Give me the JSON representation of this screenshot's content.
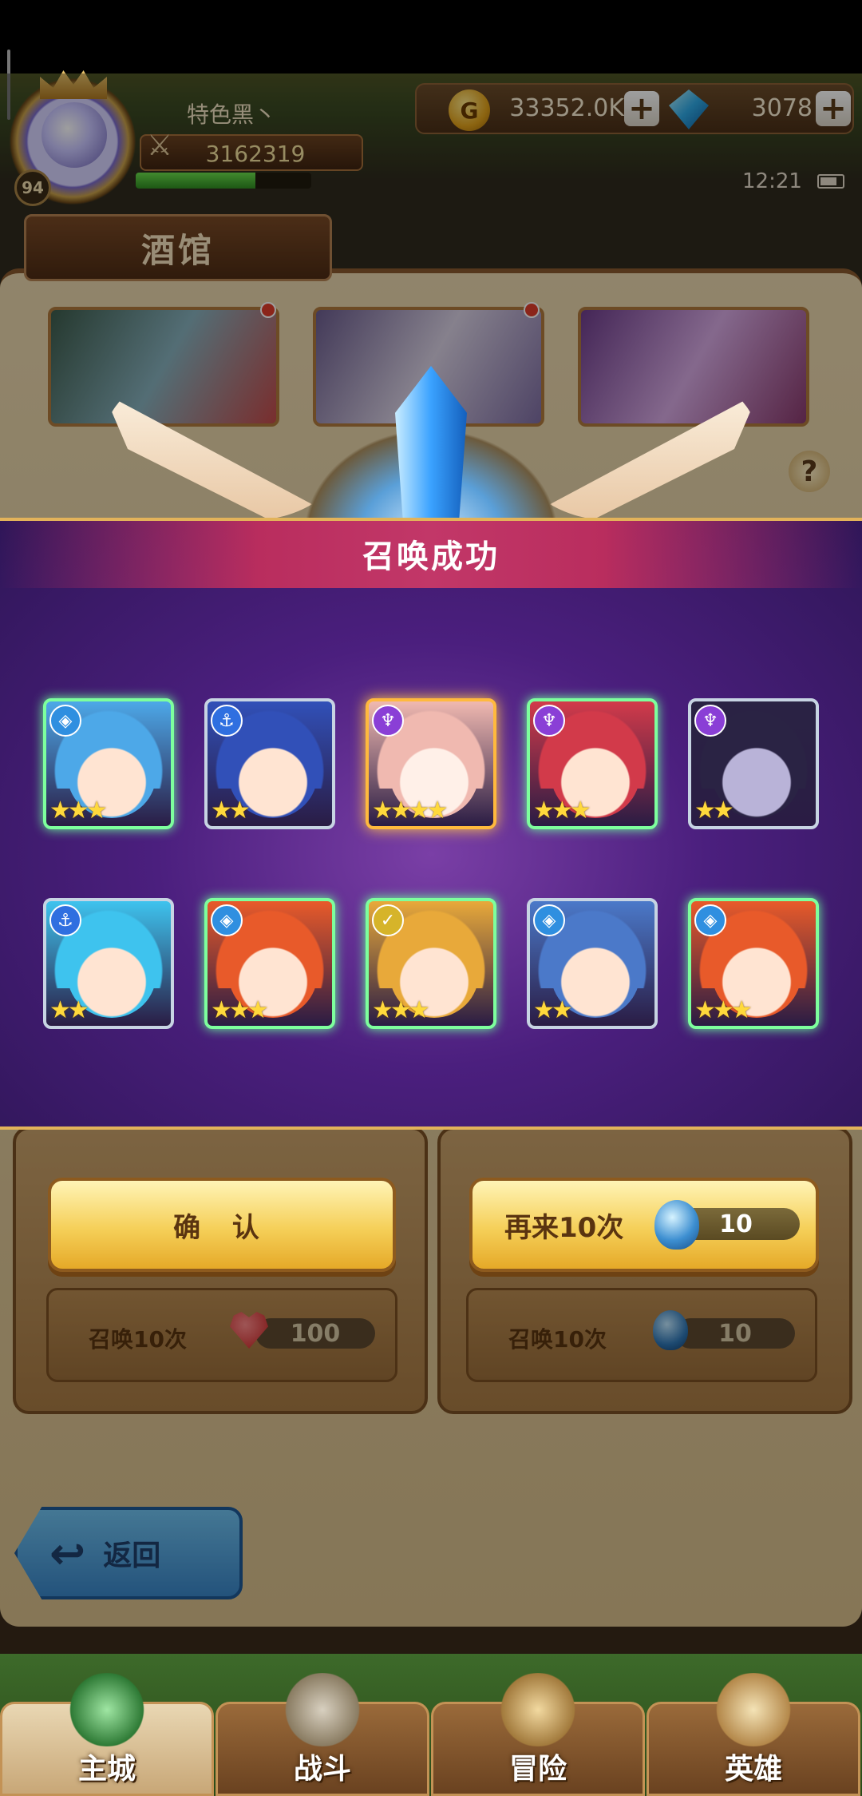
{
  "player": {
    "name": "特色黑丶",
    "power": "3162319",
    "level": "94",
    "exp_fraction": 0.68
  },
  "currency": {
    "gold": "33352.0K",
    "gems": "3078"
  },
  "status": {
    "time": "12:21"
  },
  "tavern": {
    "title": "酒馆",
    "help": "?"
  },
  "summon_result": {
    "title": "召唤成功",
    "heroes": [
      {
        "stars": 3,
        "faction": "diamond-icon",
        "faction_color": "#2f8fe0",
        "frame": "green",
        "hair": "#4da8e8",
        "face": "#ffe4d2"
      },
      {
        "stars": 2,
        "faction": "anchor-icon",
        "faction_color": "#2f6fe0",
        "frame": "silver",
        "hair": "#3150b8",
        "face": "#ffe4d2"
      },
      {
        "stars": 4,
        "faction": "horns-icon",
        "faction_color": "#8a3fd6",
        "frame": "gold",
        "hair": "#f0b9b0",
        "face": "#fff0e8"
      },
      {
        "stars": 3,
        "faction": "horns-icon",
        "faction_color": "#8a3fd6",
        "frame": "green",
        "hair": "#d23a4a",
        "face": "#ffe4d2"
      },
      {
        "stars": 2,
        "faction": "horns-icon",
        "faction_color": "#8a3fd6",
        "frame": "silver",
        "hair": "#2a2344",
        "face": "#b9b3d8"
      },
      {
        "stars": 2,
        "faction": "anchor-icon",
        "faction_color": "#2f6fe0",
        "frame": "silver",
        "hair": "#3ec3ee",
        "face": "#ffe4d2"
      },
      {
        "stars": 3,
        "faction": "diamond-icon",
        "faction_color": "#2f8fe0",
        "frame": "green",
        "hair": "#e85a2a",
        "face": "#ffe4d2"
      },
      {
        "stars": 3,
        "faction": "chevron-icon",
        "faction_color": "#d6b42a",
        "frame": "green",
        "hair": "#e8a93a",
        "face": "#ffe4d2"
      },
      {
        "stars": 2,
        "faction": "diamond-icon",
        "faction_color": "#2f8fe0",
        "frame": "silver",
        "hair": "#4b79c9",
        "face": "#ffe4d2"
      },
      {
        "stars": 3,
        "faction": "diamond-icon",
        "faction_color": "#2f8fe0",
        "frame": "green",
        "hair": "#e85a2a",
        "face": "#ffe4d2"
      }
    ],
    "confirm_label": "确 认",
    "again_label": "再来10次",
    "again_cost": "10"
  },
  "summon_options": {
    "left": {
      "label": "召唤10次",
      "cost": "100"
    },
    "right": {
      "label": "召唤10次",
      "cost": "10"
    }
  },
  "back_label": "返回",
  "nav": [
    {
      "label": "主城",
      "active": true
    },
    {
      "label": "战斗",
      "active": false
    },
    {
      "label": "冒险",
      "active": false
    },
    {
      "label": "英雄",
      "active": false
    }
  ]
}
